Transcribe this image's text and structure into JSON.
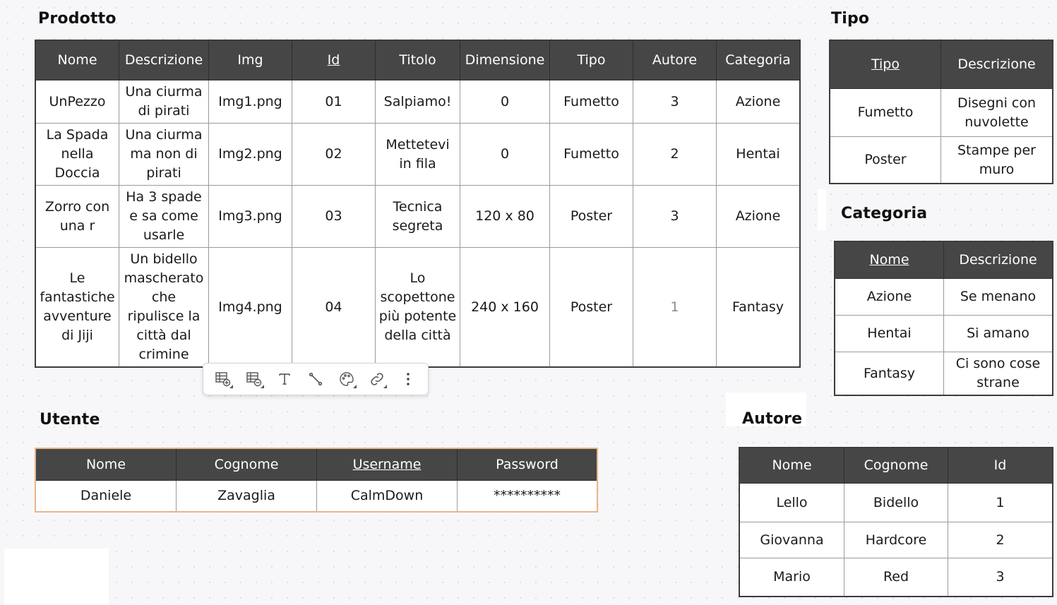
{
  "prodotto": {
    "title": "Prodotto",
    "headers": [
      {
        "label": "Nome",
        "key": false
      },
      {
        "label": "Descrizione",
        "key": false
      },
      {
        "label": "Img",
        "key": false
      },
      {
        "label": "Id",
        "key": true
      },
      {
        "label": "Titolo",
        "key": false
      },
      {
        "label": "Dimensione",
        "key": false
      },
      {
        "label": "Tipo",
        "key": false
      },
      {
        "label": "Autore",
        "key": false
      },
      {
        "label": "Categoria",
        "key": false
      }
    ],
    "rows": [
      [
        "UnPezzo",
        "Una ciurma di pirati",
        "Img1.png",
        "01",
        "Salpiamo!",
        "0",
        "Fumetto",
        "3",
        "Azione"
      ],
      [
        "La Spada nella Doccia",
        "Una ciurma ma non di pirati",
        "Img2.png",
        "02",
        "Mettetevi in fila",
        "0",
        "Fumetto",
        "2",
        "Hentai"
      ],
      [
        "Zorro con una r",
        "Ha 3 spade e sa come usarle",
        "Img3.png",
        "03",
        "Tecnica segreta",
        "120 x 80",
        "Poster",
        "3",
        "Azione"
      ],
      [
        "Le fantastiche avventure di Jiji",
        "Un bidello mascherato che ripulisce la città dal crimine",
        "Img4.png",
        "04",
        "Lo scopettone più potente della città",
        "240 x 160",
        "Poster",
        "1",
        "Fantasy"
      ]
    ]
  },
  "tipo": {
    "title": "Tipo",
    "headers": [
      {
        "label": "Tipo",
        "key": true
      },
      {
        "label": "Descrizione",
        "key": false
      }
    ],
    "rows": [
      [
        "Fumetto",
        "Disegni con nuvolette"
      ],
      [
        "Poster",
        "Stampe per muro"
      ]
    ]
  },
  "categoria": {
    "title": "Categoria",
    "headers": [
      {
        "label": "Nome",
        "key": true
      },
      {
        "label": "Descrizione",
        "key": false
      }
    ],
    "rows": [
      [
        "Azione",
        "Se menano"
      ],
      [
        "Hentai",
        "Si amano"
      ],
      [
        "Fantasy",
        "Ci sono cose strane"
      ]
    ]
  },
  "utente": {
    "title": "Utente",
    "headers": [
      {
        "label": "Nome",
        "key": false
      },
      {
        "label": "Cognome",
        "key": false
      },
      {
        "label": "Username",
        "key": true
      },
      {
        "label": "Password",
        "key": false
      }
    ],
    "rows": [
      [
        "Daniele",
        "Zavaglia",
        "CalmDown",
        "**********"
      ]
    ]
  },
  "autore": {
    "title": "Autore",
    "headers": [
      {
        "label": "Nome",
        "key": false
      },
      {
        "label": "Cognome",
        "key": false
      },
      {
        "label": "Id",
        "key": false
      }
    ],
    "rows": [
      [
        "Lello",
        "Bidello",
        "1"
      ],
      [
        "Giovanna",
        "Hardcore",
        "2"
      ],
      [
        "Mario",
        "Red",
        "3"
      ]
    ]
  },
  "toolbar": {
    "buttons": [
      {
        "icon": "table-add-row-icon"
      },
      {
        "icon": "table-remove-row-icon"
      },
      {
        "icon": "text-format-icon"
      },
      {
        "icon": "connector-line-icon"
      },
      {
        "icon": "color-palette-icon"
      },
      {
        "icon": "link-icon"
      },
      {
        "icon": "more-options-icon"
      }
    ]
  }
}
